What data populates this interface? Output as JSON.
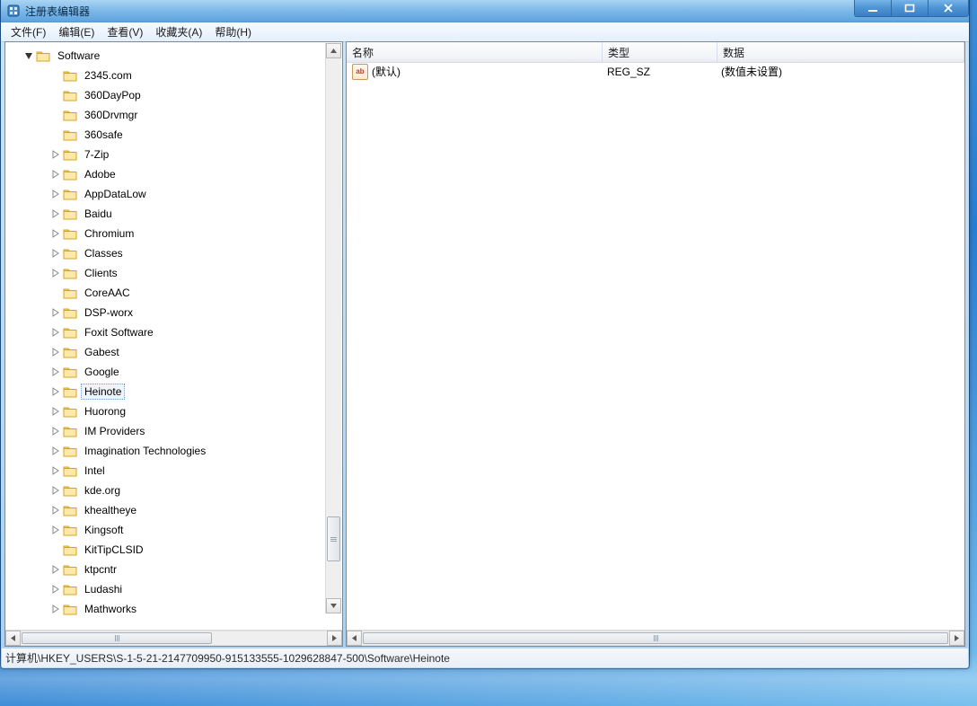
{
  "window": {
    "title": "注册表编辑器"
  },
  "menu": {
    "file": "文件(F)",
    "edit": "编辑(E)",
    "view": "查看(V)",
    "favorites": "收藏夹(A)",
    "help": "帮助(H)"
  },
  "tree": {
    "root_label": "Software",
    "items": [
      {
        "label": "2345.com",
        "expandable": false
      },
      {
        "label": "360DayPop",
        "expandable": false
      },
      {
        "label": "360Drvmgr",
        "expandable": false
      },
      {
        "label": "360safe",
        "expandable": false
      },
      {
        "label": "7-Zip",
        "expandable": true
      },
      {
        "label": "Adobe",
        "expandable": true
      },
      {
        "label": "AppDataLow",
        "expandable": true
      },
      {
        "label": "Baidu",
        "expandable": true
      },
      {
        "label": "Chromium",
        "expandable": true
      },
      {
        "label": "Classes",
        "expandable": true
      },
      {
        "label": "Clients",
        "expandable": true
      },
      {
        "label": "CoreAAC",
        "expandable": false
      },
      {
        "label": "DSP-worx",
        "expandable": true
      },
      {
        "label": "Foxit Software",
        "expandable": true
      },
      {
        "label": "Gabest",
        "expandable": true
      },
      {
        "label": "Google",
        "expandable": true
      },
      {
        "label": "Heinote",
        "expandable": true,
        "selected": true
      },
      {
        "label": "Huorong",
        "expandable": true
      },
      {
        "label": "IM Providers",
        "expandable": true
      },
      {
        "label": "Imagination Technologies",
        "expandable": true
      },
      {
        "label": "Intel",
        "expandable": true
      },
      {
        "label": "kde.org",
        "expandable": true
      },
      {
        "label": "khealtheye",
        "expandable": true
      },
      {
        "label": "Kingsoft",
        "expandable": true
      },
      {
        "label": "KitTipCLSID",
        "expandable": false
      },
      {
        "label": "ktpcntr",
        "expandable": true
      },
      {
        "label": "Ludashi",
        "expandable": true
      },
      {
        "label": "Mathworks",
        "expandable": true
      }
    ]
  },
  "list": {
    "columns": {
      "name": "名称",
      "type": "类型",
      "data": "数据"
    },
    "rows": [
      {
        "name": "(默认)",
        "type": "REG_SZ",
        "data": "(数值未设置)"
      }
    ]
  },
  "statusbar": {
    "path": "计算机\\HKEY_USERS\\S-1-5-21-2147709950-915133555-1029628847-500\\Software\\Heinote"
  }
}
